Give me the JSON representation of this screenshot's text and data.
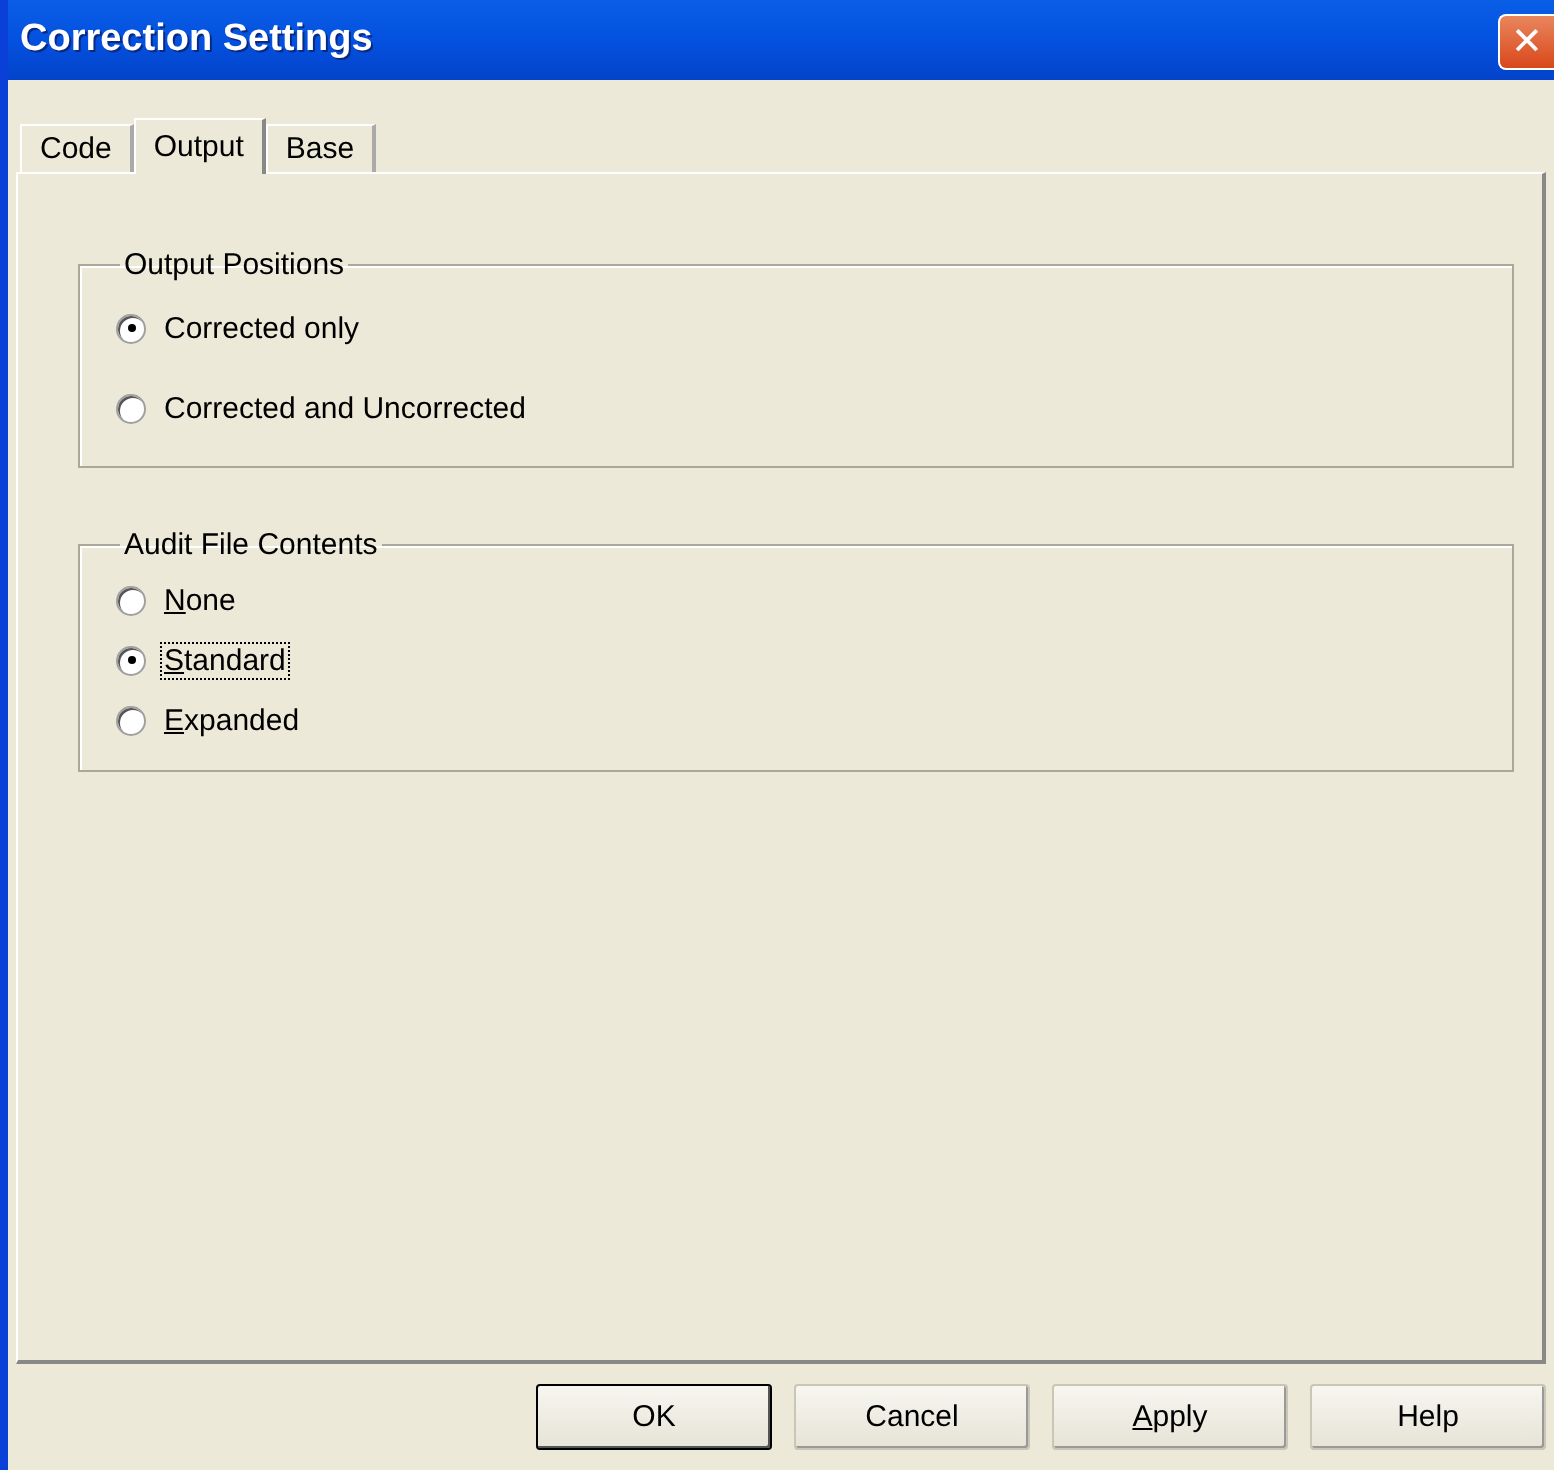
{
  "window": {
    "title": "Correction Settings",
    "close": "✕"
  },
  "tabs": [
    {
      "label": "Code",
      "selected": false
    },
    {
      "label": "Output",
      "selected": true
    },
    {
      "label": "Base",
      "selected": false
    }
  ],
  "groups": [
    {
      "title": "Output Positions",
      "spacious": true,
      "options": [
        {
          "label": "Corrected only",
          "selected": true,
          "mnemonic_first": false,
          "focused": false
        },
        {
          "label": "Corrected and Uncorrected",
          "selected": false,
          "mnemonic_first": false,
          "focused": false
        }
      ]
    },
    {
      "title": "Audit File Contents",
      "spacious": false,
      "options": [
        {
          "label": "None",
          "selected": false,
          "mnemonic_first": true,
          "focused": false
        },
        {
          "label": "Standard",
          "selected": true,
          "mnemonic_first": true,
          "focused": true
        },
        {
          "label": "Expanded",
          "selected": false,
          "mnemonic_first": true,
          "focused": false
        }
      ]
    }
  ],
  "buttons": [
    {
      "label": "OK",
      "default": true,
      "mnemonic_first": false
    },
    {
      "label": "Cancel",
      "default": false,
      "mnemonic_first": false
    },
    {
      "label": "Apply",
      "default": false,
      "mnemonic_first": true
    },
    {
      "label": "Help",
      "default": false,
      "mnemonic_first": false
    }
  ]
}
